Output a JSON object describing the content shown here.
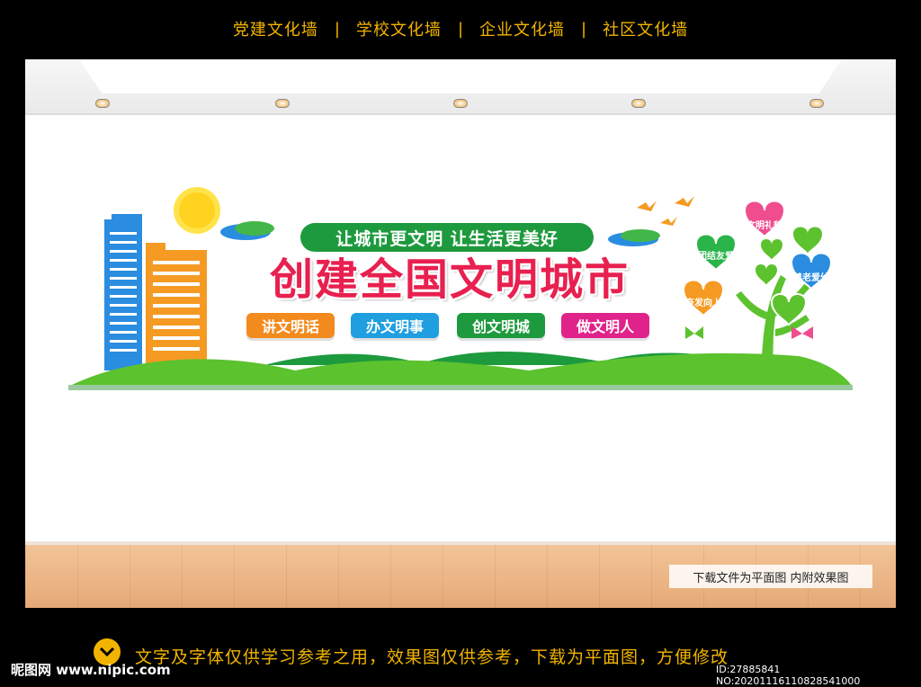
{
  "nav": {
    "items": [
      "党建文化墙",
      "学校文化墙",
      "企业文化墙",
      "社区文化墙"
    ],
    "separator": "|"
  },
  "banner": {
    "subtitle": "让城市更文明  让生活更美好",
    "title": "创建全国文明城市",
    "tags": [
      {
        "label": "讲文明话",
        "color": "#f28a1d"
      },
      {
        "label": "办文明事",
        "color": "#1f9fe0"
      },
      {
        "label": "创文明城",
        "color": "#1e9a3e"
      },
      {
        "label": "做文明人",
        "color": "#e0238a"
      }
    ],
    "hearts": [
      {
        "label": "文明礼貌",
        "color": "#f04d8f"
      },
      {
        "label": "团结友爱",
        "color": "#2ab44a"
      },
      {
        "label": "尊老爱幼",
        "color": "#2a8de0"
      },
      {
        "label": "奋发向上",
        "color": "#f59a23"
      }
    ]
  },
  "room": {
    "note": "下载文件为平面图  内附效果图"
  },
  "footer": {
    "logo": "昵图网 www.nipic.com",
    "disclaimer": "文字及字体仅供学习参考之用，效果图仅供参考，下载为平面图，方便修改",
    "id": "ID:27885841 NO:20201116110828541000"
  },
  "colors": {
    "nav_text": "#f2b400",
    "title_red": "#e8204f",
    "grass_green": "#5cc22e",
    "pill_green": "#1e9a3e"
  }
}
